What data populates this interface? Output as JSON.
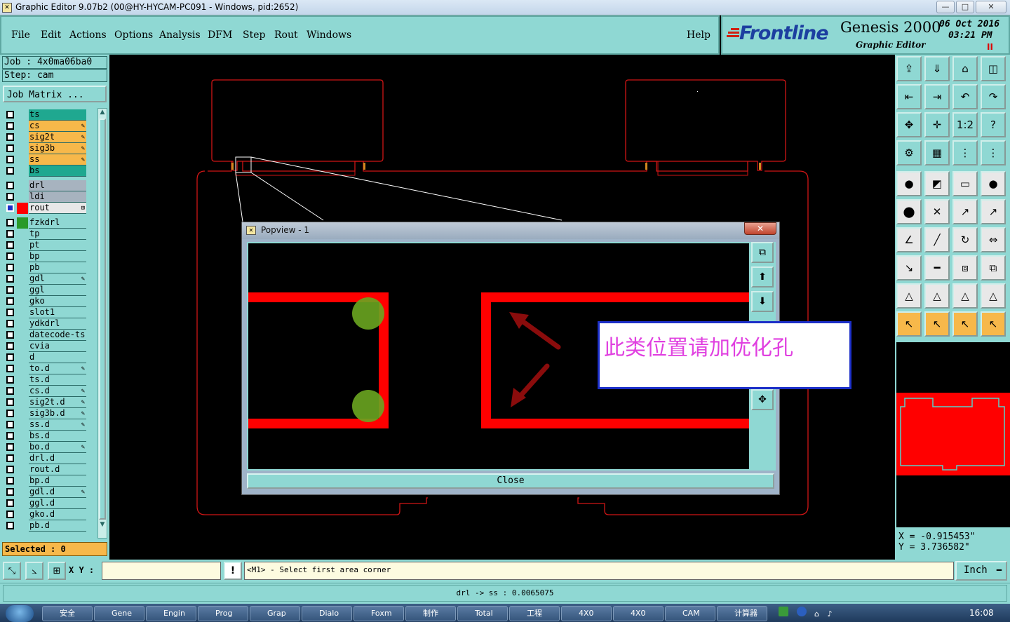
{
  "window": {
    "title": "Graphic Editor 9.07b2 (00@HY-HYCAM-PC091 - Windows, pid:2652)",
    "min": "—",
    "max": "□",
    "close": "✕"
  },
  "menu": [
    "File",
    "Edit",
    "Actions",
    "Options",
    "Analysis",
    "DFM",
    "Step",
    "Rout",
    "Windows"
  ],
  "help": "Help",
  "brand": {
    "logo": "Frontline",
    "product": "Genesis 2000",
    "subtitle": "Graphic Editor",
    "date": "06 Oct 2016",
    "time": "03:21 PM",
    "pause": "II"
  },
  "job": {
    "job_label": "Job :",
    "job_value": "4x0ma06ba0",
    "step_label": "Step:",
    "step_value": "cam",
    "job_matrix": "Job Matrix ..."
  },
  "layers": [
    {
      "name": "ts",
      "color": "#1fa890",
      "edit": false
    },
    {
      "name": "cs",
      "color": "#f7b84a",
      "edit": true
    },
    {
      "name": "sig2t",
      "color": "#f7b84a",
      "edit": true
    },
    {
      "name": "sig3b",
      "color": "#f7b84a",
      "edit": true
    },
    {
      "name": "ss",
      "color": "#f7b84a",
      "edit": true
    },
    {
      "name": "bs",
      "color": "#1fa890",
      "edit": false
    },
    {
      "name": "drl",
      "color": "#a7b3bf",
      "edit": false
    },
    {
      "name": "ldi",
      "color": "#a7b3bf",
      "edit": false
    },
    {
      "name": "rout",
      "color": "#e8e8e8",
      "edit": false,
      "active": true
    },
    {
      "name": "fzkdrl",
      "color": "#8fd8d3",
      "edit": false,
      "swatch": "#2a9a2a"
    },
    {
      "name": "tp",
      "color": "#8fd8d3",
      "edit": false
    },
    {
      "name": "pt",
      "color": "#8fd8d3",
      "edit": false
    },
    {
      "name": "bp",
      "color": "#8fd8d3",
      "edit": false
    },
    {
      "name": "pb",
      "color": "#8fd8d3",
      "edit": false
    },
    {
      "name": "gdl",
      "color": "#8fd8d3",
      "edit": true
    },
    {
      "name": "ggl",
      "color": "#8fd8d3",
      "edit": false
    },
    {
      "name": "gko",
      "color": "#8fd8d3",
      "edit": false
    },
    {
      "name": "slot1",
      "color": "#8fd8d3",
      "edit": false
    },
    {
      "name": "ydkdrl",
      "color": "#8fd8d3",
      "edit": false
    },
    {
      "name": "datecode-ts",
      "color": "#8fd8d3",
      "edit": false
    },
    {
      "name": "cvia",
      "color": "#8fd8d3",
      "edit": false
    },
    {
      "name": "d",
      "color": "#8fd8d3",
      "edit": false
    },
    {
      "name": "to.d",
      "color": "#8fd8d3",
      "edit": true
    },
    {
      "name": "ts.d",
      "color": "#8fd8d3",
      "edit": false
    },
    {
      "name": "cs.d",
      "color": "#8fd8d3",
      "edit": true
    },
    {
      "name": "sig2t.d",
      "color": "#8fd8d3",
      "edit": true
    },
    {
      "name": "sig3b.d",
      "color": "#8fd8d3",
      "edit": true
    },
    {
      "name": "ss.d",
      "color": "#8fd8d3",
      "edit": true
    },
    {
      "name": "bs.d",
      "color": "#8fd8d3",
      "edit": false
    },
    {
      "name": "bo.d",
      "color": "#8fd8d3",
      "edit": true
    },
    {
      "name": "drl.d",
      "color": "#8fd8d3",
      "edit": false
    },
    {
      "name": "rout.d",
      "color": "#8fd8d3",
      "edit": false
    },
    {
      "name": "bp.d",
      "color": "#8fd8d3",
      "edit": false
    },
    {
      "name": "gdl.d",
      "color": "#8fd8d3",
      "edit": true
    },
    {
      "name": "ggl.d",
      "color": "#8fd8d3",
      "edit": false
    },
    {
      "name": "gko.d",
      "color": "#8fd8d3",
      "edit": false
    },
    {
      "name": "pb.d",
      "color": "#8fd8d3",
      "edit": false
    }
  ],
  "selected": "Selected : 0",
  "popview": {
    "title": "Popview - 1",
    "close_label": "Close",
    "annotation": "此类位置请加优化孔"
  },
  "coords": {
    "x": "X = -0.915453\"",
    "y": "Y = 3.736582\""
  },
  "status": {
    "xy_label": "X Y :",
    "xy_value": "",
    "prompt_mark": "!",
    "message": "<M1> - Select first area corner",
    "units": "Inch",
    "info": "drl -> ss : 0.0065075"
  },
  "taskbar": {
    "items": [
      "安全",
      "Gene",
      "Engin",
      "Prog",
      "Grap",
      "Dialo",
      "Foxm",
      "制作",
      "Total",
      "工程",
      "4X0",
      "4X0",
      "CAM",
      "计算器"
    ],
    "clock": "16:08"
  },
  "toolbar_icons": [
    "layer-up-icon",
    "layer-down-icon",
    "home-icon",
    "window-split-icon",
    "prev-step-icon",
    "next-step-icon",
    "undo-icon",
    "redo-icon",
    "zoom-fit-icon",
    "zoom-center-icon",
    "zoom-1to1-icon",
    "help-icon",
    "settings-icon",
    "grid-icon",
    "snap-red-icon",
    "snap-red2-icon",
    "pad-icon",
    "line-icon",
    "measure-ruler-icon",
    "circle-fill-icon",
    "nodes-icon",
    "cross-icon",
    "point-line-icon",
    "point-line2-icon",
    "angle-icon",
    "diagonal-icon",
    "rotate-icon",
    "mirror-icon",
    "select-red-icon",
    "move-line-icon",
    "stretch-icon",
    "copy-shape-icon",
    "triangle-a-icon",
    "triangle-b-icon",
    "triangle-c-icon",
    "triangle-d-icon",
    "pointer-icon",
    "pointer-box-icon",
    "pointer-circle-icon",
    "pointer-multi-icon"
  ]
}
